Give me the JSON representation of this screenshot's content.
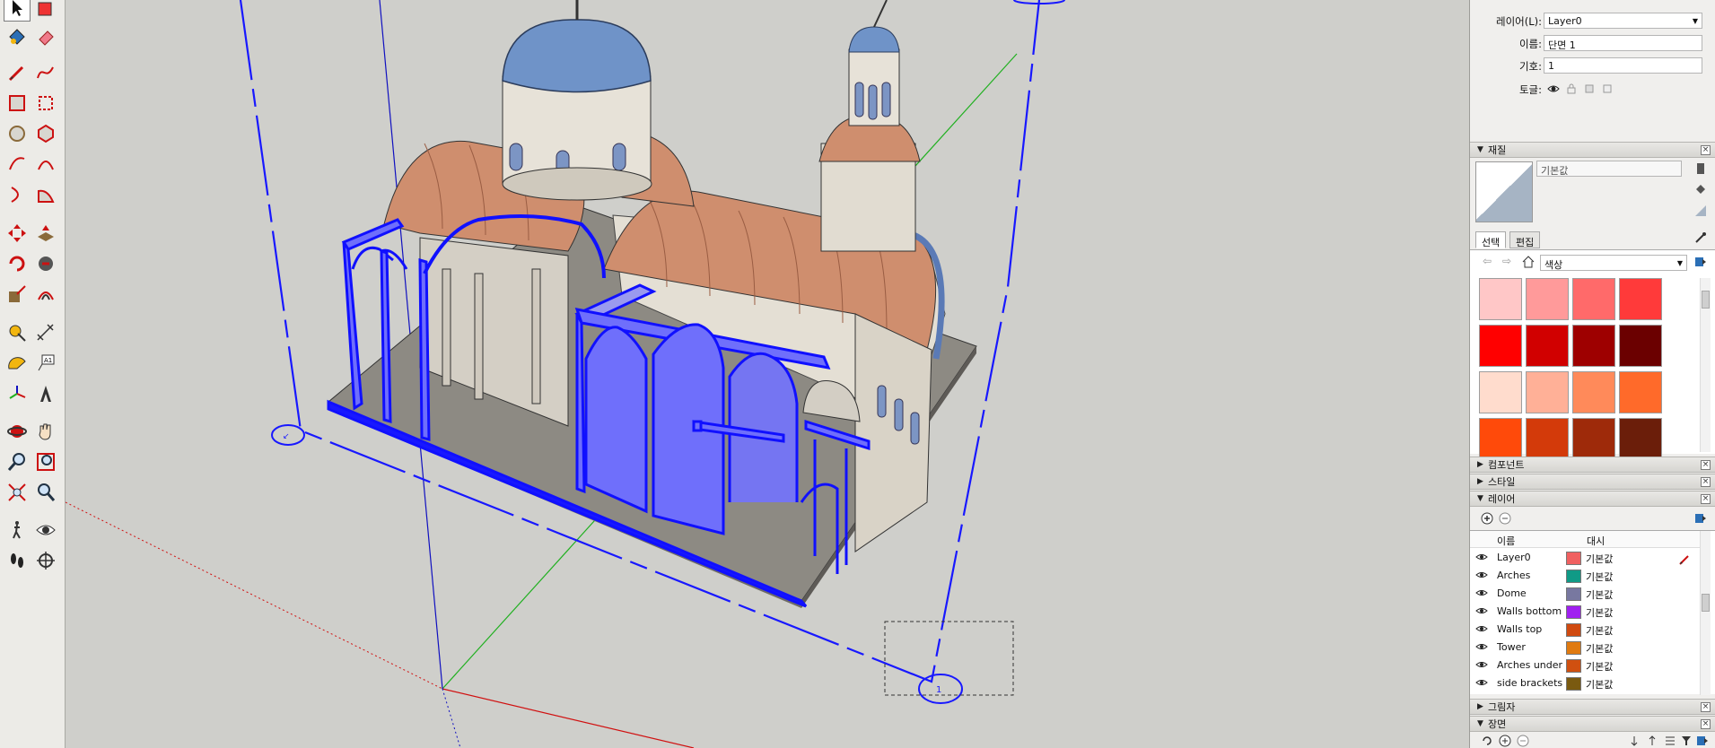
{
  "entity_info": {
    "layer_label": "레이어(L):",
    "layer_value": "Layer0",
    "name_label": "이름:",
    "name_value": "단면 1",
    "symbol_label": "기호:",
    "symbol_value": "1",
    "toggle_label": "토글:"
  },
  "materials": {
    "header": "재질",
    "material_name": "기본값",
    "tab_select": "선택",
    "tab_edit": "편집",
    "library": "색상",
    "swatches": [
      "#ffc7c7",
      "#ff9a9a",
      "#ff6a6a",
      "#ff3a3a",
      "#ff0000",
      "#d10000",
      "#9e0000",
      "#6b0000",
      "#ffdccd",
      "#ffb097",
      "#ff8a5a",
      "#ff6a2a",
      "#ff4a0a",
      "#d33a0a",
      "#9e2a0a",
      "#6b1e0a"
    ]
  },
  "collapsed_sections": {
    "components": "컴포넌트",
    "styles": "스타일"
  },
  "layers": {
    "header": "레이어",
    "col_name": "이름",
    "col_dash": "대시",
    "rows": [
      {
        "name": "Layer0",
        "color": "#f06060",
        "dash": "기본값"
      },
      {
        "name": "Arches",
        "color": "#109a86",
        "dash": "기본값"
      },
      {
        "name": "Dome",
        "color": "#7878a0",
        "dash": "기본값"
      },
      {
        "name": "Walls bottom",
        "color": "#a020f0",
        "dash": "기본값"
      },
      {
        "name": "Walls top",
        "color": "#d04a10",
        "dash": "기본값"
      },
      {
        "name": "Tower",
        "color": "#e07a10",
        "dash": "기본값"
      },
      {
        "name": "Arches under",
        "color": "#d05010",
        "dash": "기본값"
      },
      {
        "name": "side brackets",
        "color": "#7a5a10",
        "dash": "기본값"
      }
    ]
  },
  "shadows": {
    "header": "그림자"
  },
  "scenes": {
    "header": "장면"
  },
  "section_plane": {
    "label_a": "↙",
    "label_b": "1"
  },
  "colors": {
    "selection_blue": "#1818ff",
    "axis_red": "#d01010",
    "axis_green": "#20b020",
    "axis_blue": "#1010c0"
  },
  "tools": [
    "select-tool-icon",
    "paint-bucket-icon",
    "eraser-icon",
    "pencil-icon",
    "freehand-icon",
    "rectangle-icon",
    "rotated-rectangle-icon",
    "circle-icon",
    "polygon-icon",
    "arc-icon",
    "two-point-arc-icon",
    "three-point-arc-icon",
    "pie-icon",
    "move-icon",
    "push-pull-icon",
    "rotate-icon",
    "follow-me-icon",
    "scale-icon",
    "offset-icon",
    "tape-measure-icon",
    "dimension-icon",
    "protractor-icon",
    "text-icon",
    "axes-icon",
    "3d-text-icon",
    "orbit-icon",
    "pan-icon",
    "zoom-icon",
    "zoom-window-icon",
    "zoom-extents-icon",
    "previous-view-icon",
    "walk-icon",
    "look-around-icon",
    "footprints-icon",
    "section-plane-icon"
  ]
}
